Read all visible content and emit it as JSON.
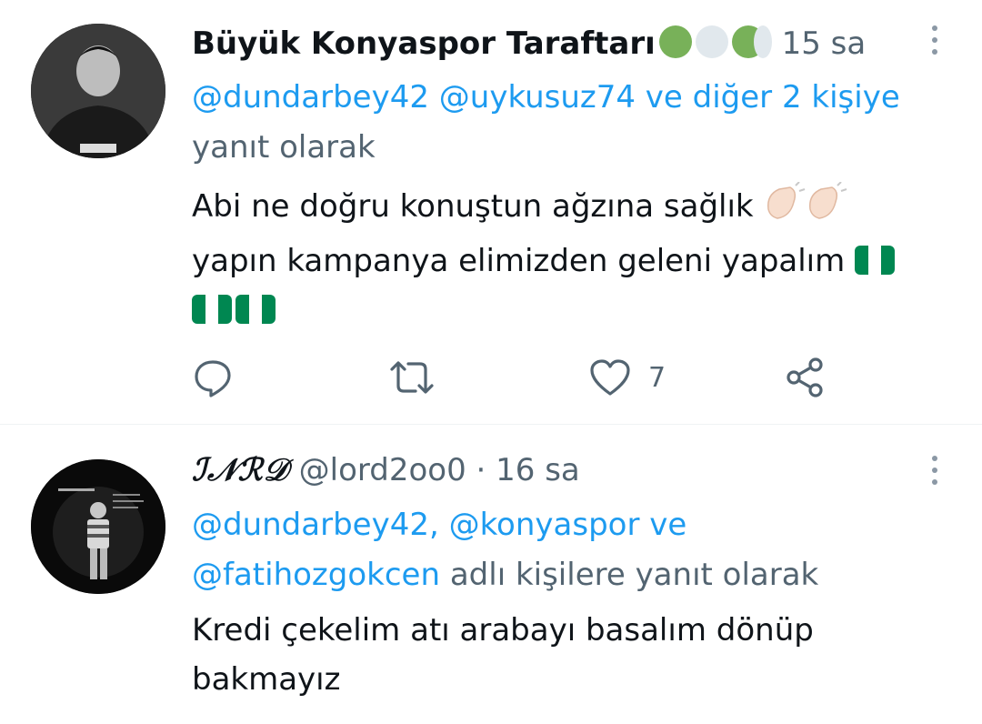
{
  "tweets": [
    {
      "author_name": "Büyük Konyaspor Taraftarı",
      "time": "15 sa",
      "reply_mentions": "@dundarbey42 @uykusuz74 ve diğer 2 kişiye",
      "reply_suffix": "yanıt olarak",
      "text_line1": "Abi ne doğru konuştun ağzına sağlık",
      "text_line2": "yapın kampanya elimizden geleni yapalım",
      "like_count": "7"
    },
    {
      "author_name": "ℐ𝒩ℛ𝒟",
      "handle": "@lord2oo0",
      "time": "16 sa",
      "reply_link1": "@dundarbey42, @konyaspor ve",
      "reply_link2": "@fatihozgokcen",
      "reply_suffix": "adlı kişilere yanıt olarak",
      "text_line1": "Kredi çekelim atı arabayı basalım dönüp",
      "text_line2": "bakmayız"
    }
  ],
  "icons": [
    "reply-icon",
    "retweet-icon",
    "like-icon",
    "share-icon",
    "more-options-icon",
    "clap-emoji",
    "nigeria-flag-emoji"
  ],
  "colors": {
    "link": "#1d9bf0",
    "muted": "#536471",
    "text": "#0f1419",
    "badge_green": "#78b159",
    "badge_gray": "#e1e8ed"
  }
}
